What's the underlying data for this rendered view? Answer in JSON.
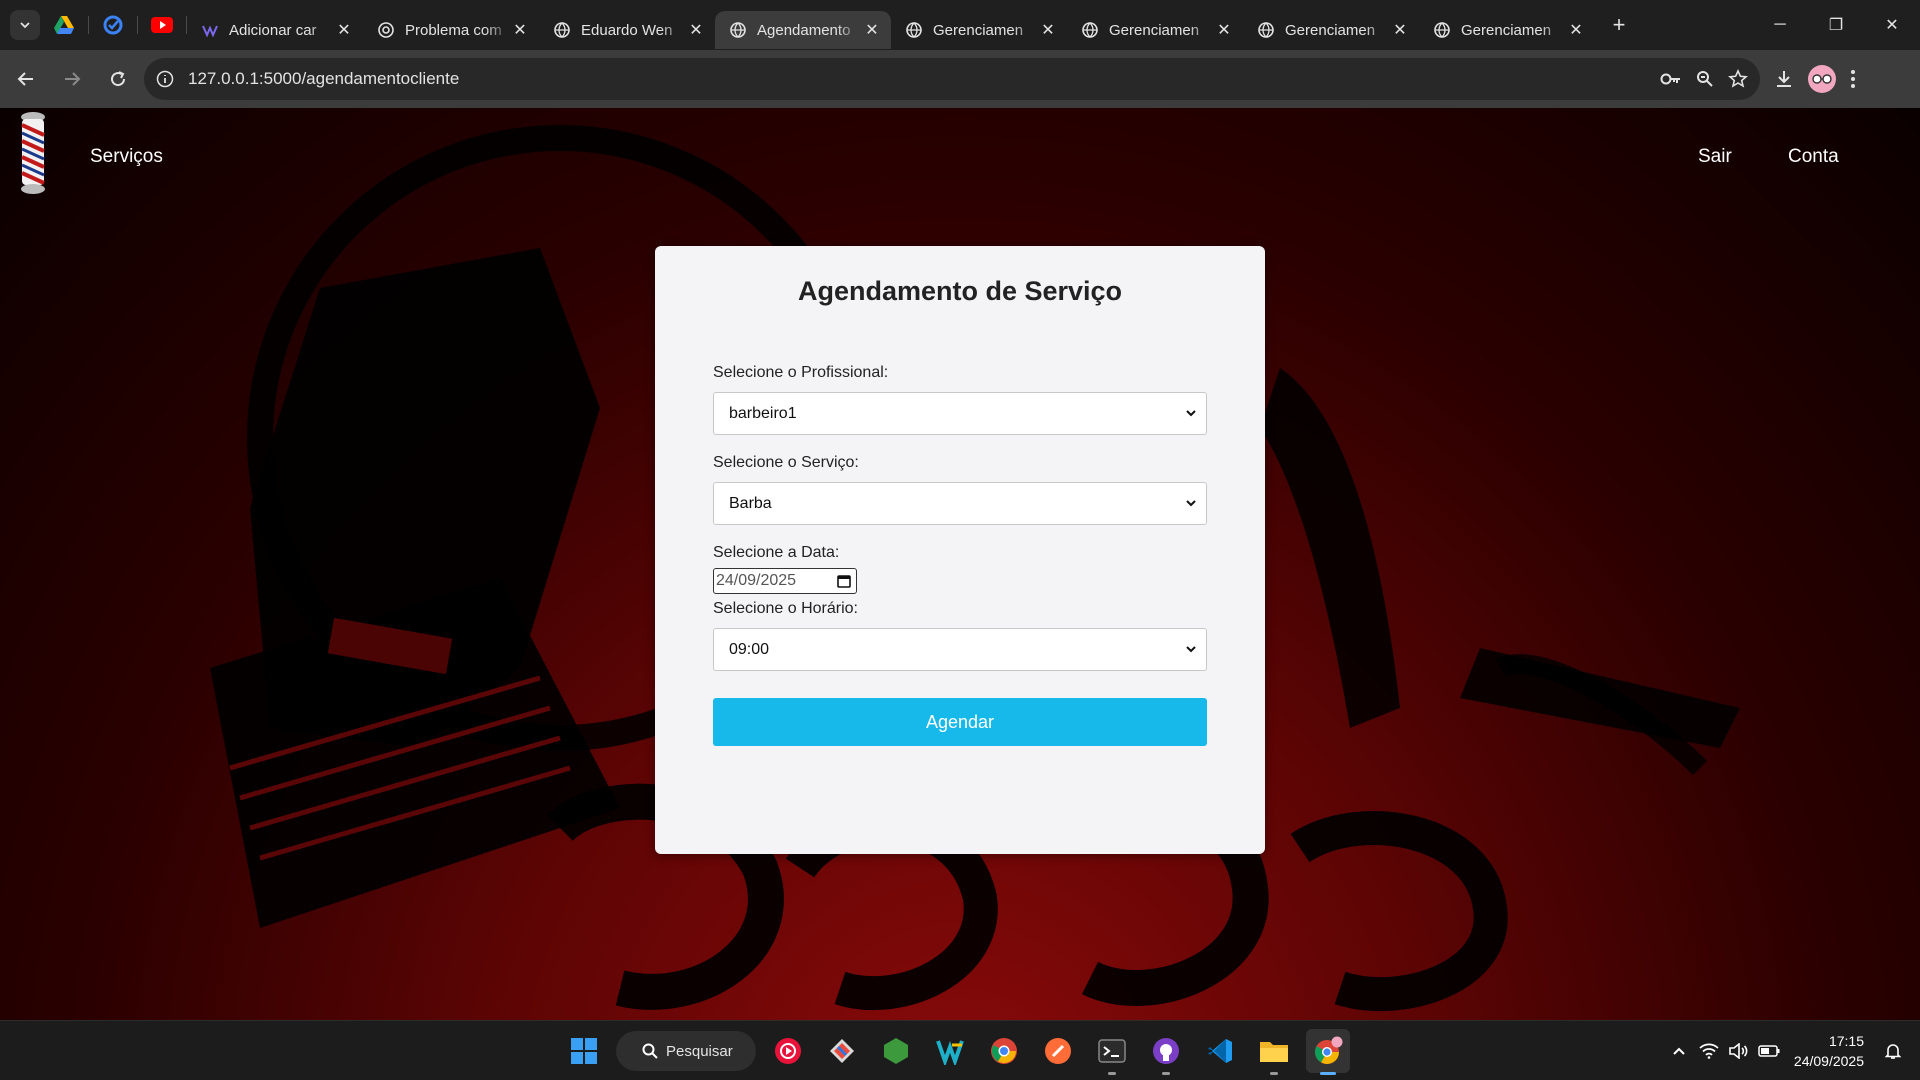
{
  "browser": {
    "tabs": [
      {
        "title": "Adicionar car",
        "active": false
      },
      {
        "title": "Problema com",
        "active": false
      },
      {
        "title": "Eduardo Wen",
        "active": false
      },
      {
        "title": "Agendamento",
        "active": true
      },
      {
        "title": "Gerenciamen",
        "active": false
      },
      {
        "title": "Gerenciamen",
        "active": false
      },
      {
        "title": "Gerenciamen",
        "active": false
      },
      {
        "title": "Gerenciamen",
        "active": false
      }
    ],
    "url": "127.0.0.1:5000/agendamentocliente"
  },
  "nav": {
    "services": "Serviços",
    "logout": "Sair",
    "account": "Conta"
  },
  "form": {
    "title": "Agendamento de Serviço",
    "professional_label": "Selecione o Profissional:",
    "professional_value": "barbeiro1",
    "service_label": "Selecione o Serviço:",
    "service_value": "Barba",
    "date_label": "Selecione a Data:",
    "date_value": "24/09/2025",
    "time_label": "Selecione o Horário:",
    "time_value": "09:00",
    "submit": "Agendar"
  },
  "taskbar": {
    "search": "Pesquisar",
    "time": "17:15",
    "date": "24/09/2025"
  },
  "colors": {
    "accent": "#17b8ea",
    "background_red": "#8a0a0a",
    "card": "#f4f4f7"
  }
}
